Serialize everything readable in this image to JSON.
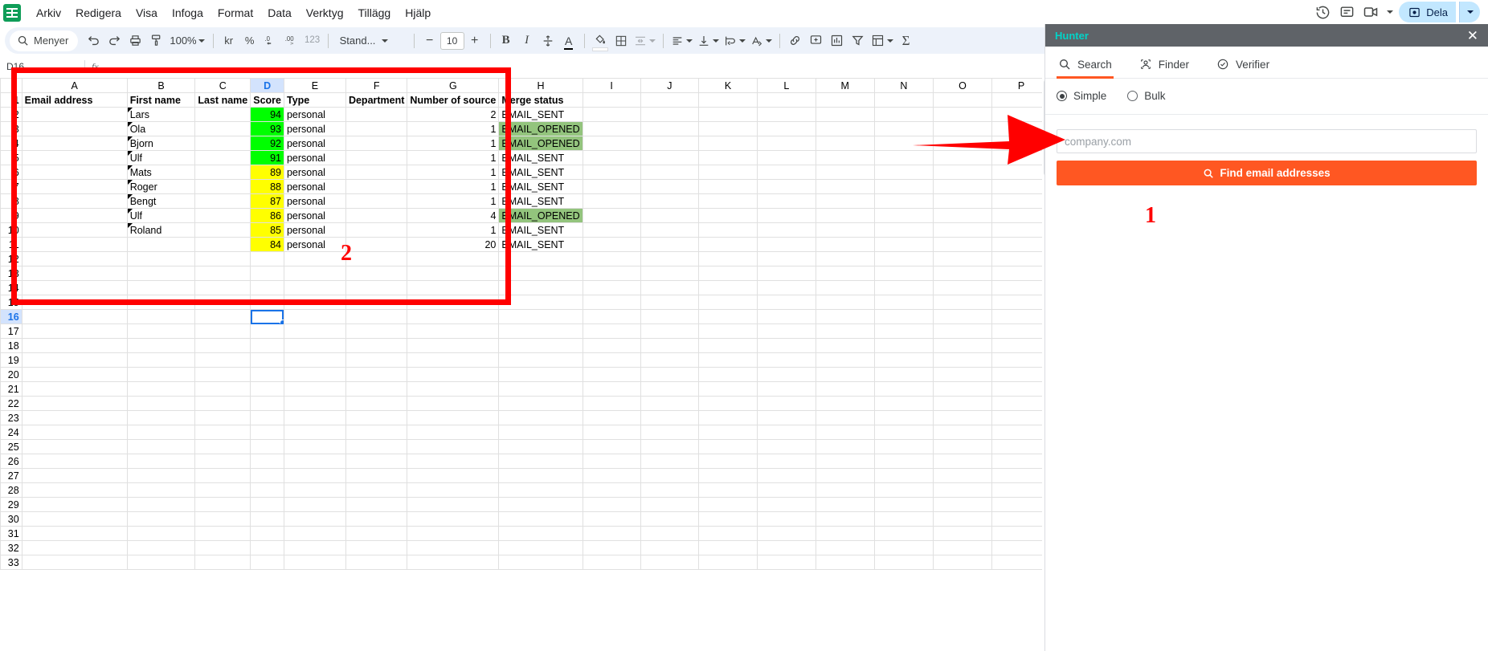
{
  "app": {
    "logo_icon": "sheets-logo",
    "menus": [
      "Arkiv",
      "Redigera",
      "Visa",
      "Infoga",
      "Format",
      "Data",
      "Verktyg",
      "Tillägg",
      "Hjälp"
    ]
  },
  "topright": {
    "history_icon": "history-clock-icon",
    "comment_icon": "comment-icon",
    "meet_icon": "video-camera-icon",
    "meet_caret": "▾",
    "share_label": "Dela",
    "share_icon": "share-lock-icon",
    "share_caret": "▾"
  },
  "toolbar": {
    "search_label": "Menyer",
    "search_icon": "search-icon",
    "undo_icon": "undo-icon",
    "redo_icon": "redo-icon",
    "print_icon": "print-icon",
    "paint_format_icon": "paint-format-icon",
    "zoom_value": "100%",
    "currency_icon": "kr",
    "percent_icon": "%",
    "decimal_dec_icon": ".0",
    "decimal_inc_icon": ".00",
    "more_formats_icon": "123",
    "font_name": "Stand...",
    "font_decrease": "−",
    "font_size": "10",
    "font_increase": "+",
    "bold": "B",
    "italic": "I",
    "strikethrough_icon": "strikethrough-icon",
    "text_color": "A",
    "fill_color_icon": "fill-color-icon",
    "borders_icon": "borders-icon",
    "merge_icon": "merge-cells-icon",
    "halign_icon": "horizontal-align-icon",
    "valign_icon": "vertical-align-icon",
    "wrap_icon": "text-wrap-icon",
    "rotate_icon": "text-rotation-icon",
    "link_icon": "insert-link-icon",
    "comment_icon": "insert-comment-icon",
    "chart_icon": "insert-chart-icon",
    "filter_icon": "filter-icon",
    "functions_icon": "pivot-table-icon",
    "sum_icon": "Σ",
    "collapse_icon": "collapse-toolbar-icon"
  },
  "formula_bar": {
    "name_box": "D16",
    "fx_label": "fx",
    "value": ""
  },
  "sheet": {
    "columns": [
      "A",
      "B",
      "C",
      "D",
      "E",
      "F",
      "G",
      "H",
      "I",
      "J",
      "K",
      "L",
      "M",
      "N",
      "O",
      "P"
    ],
    "selected_column": "D",
    "selected_row": 16,
    "selected_cell": "D16",
    "row_numbers": [
      1,
      2,
      3,
      4,
      5,
      6,
      7,
      8,
      9,
      10,
      11,
      12,
      13,
      14,
      15,
      16,
      17,
      18,
      19,
      20,
      21,
      22,
      23,
      24,
      25,
      26,
      27,
      28,
      29,
      30,
      31,
      32,
      33
    ],
    "headers": {
      "A": "Email address",
      "B": "First name",
      "C": "Last name",
      "D": "Score",
      "E": "Type",
      "F": "Department",
      "G": "Number of source",
      "H": "Merge status"
    },
    "rows": [
      {
        "row": 2,
        "A": "",
        "B": "Lars",
        "C": "",
        "D": "94",
        "E": "personal",
        "F": "",
        "G": "2",
        "H": "EMAIL_SENT",
        "score_color": "#00ff00",
        "h_color": ""
      },
      {
        "row": 3,
        "A": "",
        "B": "Ola",
        "C": "",
        "D": "93",
        "E": "personal",
        "F": "",
        "G": "1",
        "H": "EMAIL_OPENED",
        "score_color": "#00ff00",
        "h_color": "#93c47d"
      },
      {
        "row": 4,
        "A": "",
        "B": "Bjorn",
        "C": "",
        "D": "92",
        "E": "personal",
        "F": "",
        "G": "1",
        "H": "EMAIL_OPENED",
        "score_color": "#00ff00",
        "h_color": "#93c47d"
      },
      {
        "row": 5,
        "A": "",
        "B": "Ulf",
        "C": "",
        "D": "91",
        "E": "personal",
        "F": "",
        "G": "1",
        "H": "EMAIL_SENT",
        "score_color": "#00ff00",
        "h_color": ""
      },
      {
        "row": 6,
        "A": "",
        "B": "Mats",
        "C": "",
        "D": "89",
        "E": "personal",
        "F": "",
        "G": "1",
        "H": "EMAIL_SENT",
        "score_color": "#ffff00",
        "h_color": ""
      },
      {
        "row": 7,
        "A": "",
        "B": "Roger",
        "C": "",
        "D": "88",
        "E": "personal",
        "F": "",
        "G": "1",
        "H": "EMAIL_SENT",
        "score_color": "#ffff00",
        "h_color": ""
      },
      {
        "row": 8,
        "A": "",
        "B": "Bengt",
        "C": "",
        "D": "87",
        "E": "personal",
        "F": "",
        "G": "1",
        "H": "EMAIL_SENT",
        "score_color": "#ffff00",
        "h_color": ""
      },
      {
        "row": 9,
        "A": "",
        "B": "Ulf",
        "C": "",
        "D": "86",
        "E": "personal",
        "F": "",
        "G": "4",
        "H": "EMAIL_OPENED",
        "score_color": "#ffff00",
        "h_color": "#93c47d"
      },
      {
        "row": 10,
        "A": "",
        "B": "Roland",
        "C": "",
        "D": "85",
        "E": "personal",
        "F": "",
        "G": "1",
        "H": "EMAIL_SENT",
        "score_color": "#ffff00",
        "h_color": ""
      },
      {
        "row": 11,
        "A": "",
        "B": "",
        "C": "",
        "D": "84",
        "E": "personal",
        "F": "",
        "G": "20",
        "H": "EMAIL_SENT",
        "score_color": "#ffff00",
        "h_color": ""
      }
    ]
  },
  "annotations": {
    "step_one": "1",
    "step_two": "2",
    "arrow_color": "#ff0000",
    "box_color": "#ff0000"
  },
  "hunter": {
    "title": "Hunter",
    "close_icon": "close-icon",
    "tabs": [
      {
        "label": "Search",
        "icon": "search-icon",
        "active": true
      },
      {
        "label": "Finder",
        "icon": "person-find-icon",
        "active": false
      },
      {
        "label": "Verifier",
        "icon": "check-circle-icon",
        "active": false
      }
    ],
    "modes": [
      {
        "label": "Simple",
        "selected": true
      },
      {
        "label": "Bulk",
        "selected": false
      }
    ],
    "domain_input": {
      "value": "",
      "placeholder": "company.com"
    },
    "find_button": {
      "label": "Find email addresses",
      "icon": "search-icon",
      "color": "#ff5722"
    }
  }
}
